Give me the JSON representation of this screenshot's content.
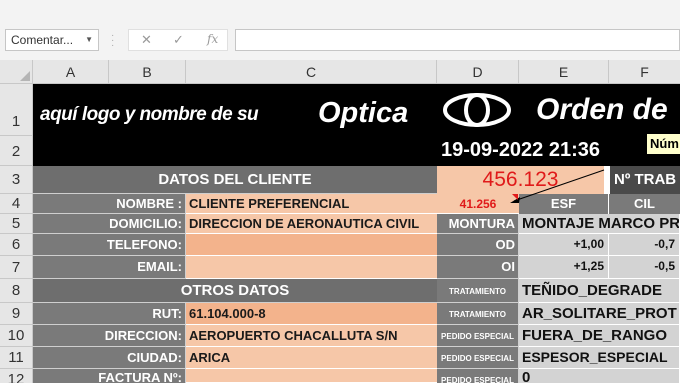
{
  "formula_bar": {
    "name_box": "Comentar...",
    "fx_label": "fx",
    "formula": ""
  },
  "columns": [
    "A",
    "B",
    "C",
    "D",
    "E",
    "F"
  ],
  "rows": [
    "1",
    "2",
    "3",
    "4",
    "5",
    "6",
    "7",
    "8",
    "9",
    "10",
    "11",
    "12"
  ],
  "header": {
    "logo_text": "aquí logo y nombre de su",
    "optica": "Optica",
    "orden": "Orden de",
    "datetime": "19-09-2022 21:36",
    "numero_label": "Núm"
  },
  "order": {
    "number": "456.123",
    "note": "41.256"
  },
  "cliente": {
    "title": "DATOS DEL CLIENTE",
    "nombre_label": "NOMBRE :",
    "nombre": "CLIENTE PREFERENCIAL",
    "domicilio_label": "DOMICILIO:",
    "domicilio": "DIRECCION DE AERONAUTICA CIVIL",
    "telefono_label": "TELEFONO:",
    "telefono": "",
    "email_label": "EMAIL:",
    "email": ""
  },
  "otros": {
    "title": "OTROS DATOS",
    "rut_label": "RUT:",
    "rut": "61.104.000-8",
    "direccion_label": "DIRECCION:",
    "direccion": "AEROPUERTO CHACALLUTA S/N",
    "ciudad_label": "CIUDAD:",
    "ciudad": "ARICA",
    "factura_label": "FACTURA Nº:",
    "factura": ""
  },
  "trabajo": {
    "title": "Nº TRAB",
    "esf": "ESF",
    "cil": "CIL",
    "montura_label": "MONTURA",
    "montura": "MONTAJE MARCO PROP",
    "od_label": "OD",
    "od_esf": "+1,00",
    "od_cil": "-0,7",
    "oi_label": "OI",
    "oi_esf": "+1,25",
    "oi_cil": "-0,5",
    "tratamiento_label": "TRATAMIENTO",
    "tratamiento1": "TEÑIDO_DEGRADE",
    "tratamiento2": "AR_SOLITARE_PROT",
    "pedido_label": "PEDIDO ESPECIAL",
    "pedido1": "FUERA_DE_RANGO",
    "pedido2": "ESPESOR_ESPECIAL",
    "pedido3": "0"
  },
  "colors": {
    "dark": "#000000",
    "label_gray": "#7a7a7a",
    "value_peach": "#f6c7a8",
    "order_red": "#e01a1a"
  }
}
